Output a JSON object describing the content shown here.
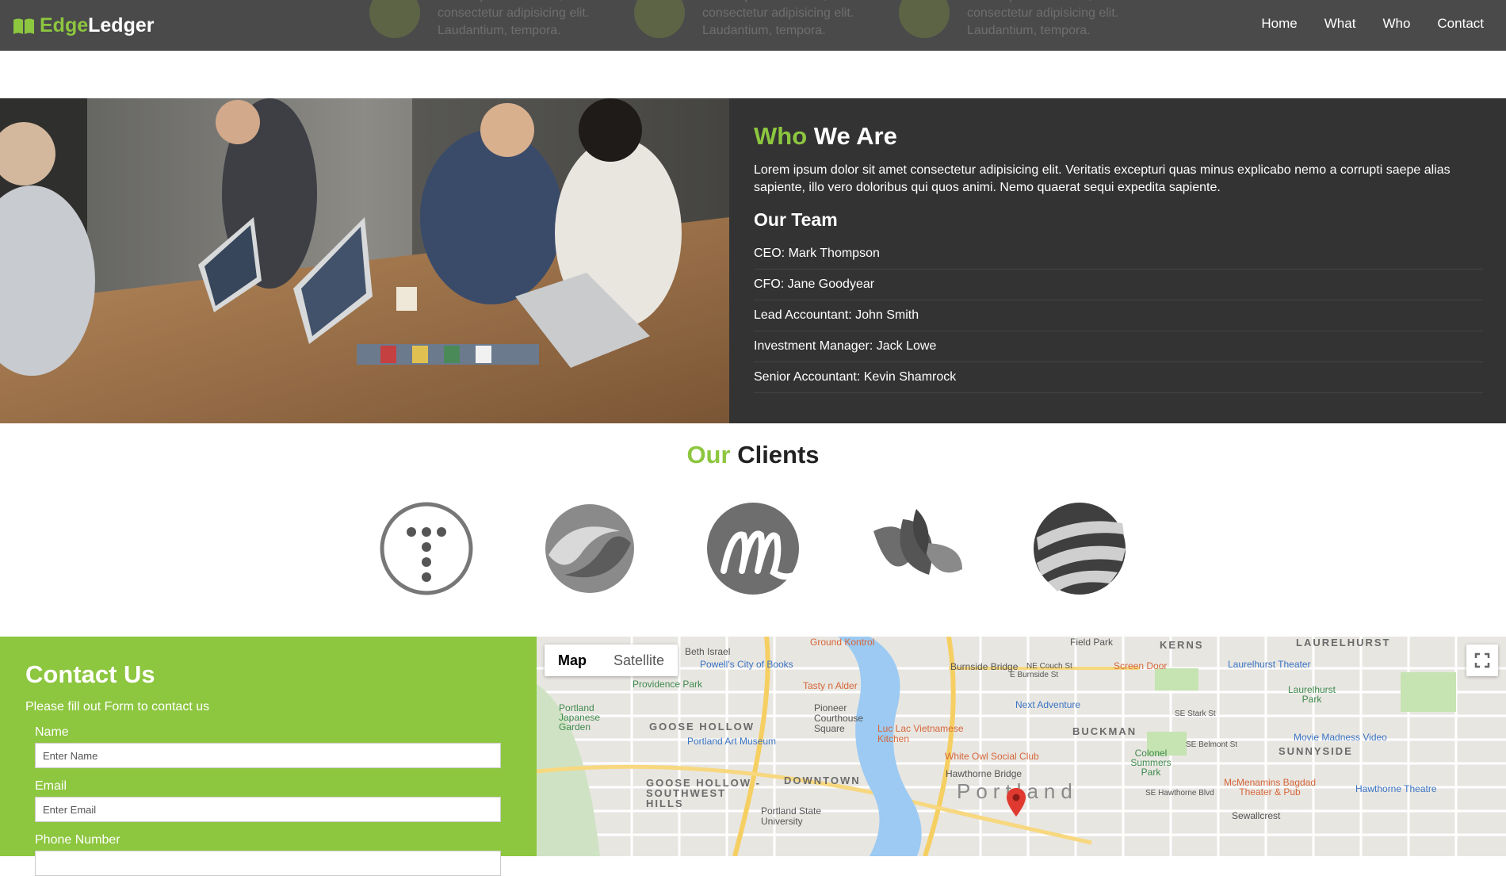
{
  "nav": {
    "brand_part1": "Edge",
    "brand_part2": "Ledger",
    "links": [
      "Home",
      "What",
      "Who",
      "Contact"
    ],
    "ghost_text": "Lorem ipsum dolor sit, amet consectetur adipisicing elit. Laudantium, tempora."
  },
  "who": {
    "title_accent": "Who",
    "title_rest": "We Are",
    "description": "Lorem ipsum dolor sit amet consectetur adipisicing elit. Veritatis excepturi quas minus explicabo nemo a corrupti saepe alias sapiente, illo vero doloribus qui quos animi. Nemo quaerat sequi expedita sapiente.",
    "team_title": "Our Team",
    "team": [
      "CEO: Mark Thompson",
      "CFO: Jane Goodyear",
      "Lead Accountant: John Smith",
      "Investment Manager: Jack Lowe",
      "Senior Accountant: Kevin Shamrock"
    ]
  },
  "clients": {
    "title_accent": "Our",
    "title_rest": "Clients",
    "logos": [
      "t-dots-logo",
      "swirl-sphere-logo",
      "m-circle-logo",
      "leaves-logo",
      "striped-globe-logo"
    ]
  },
  "contact": {
    "title": "Contact Us",
    "subtitle": "Please fill out Form to contact us",
    "fields": [
      {
        "label": "Name",
        "placeholder": "Enter Name"
      },
      {
        "label": "Email",
        "placeholder": "Enter Email"
      },
      {
        "label": "Phone Number",
        "placeholder": ""
      }
    ]
  },
  "map": {
    "toggle": [
      "Map",
      "Satellite"
    ],
    "active": "Map",
    "city": "Portland",
    "labels": {
      "beth_israel": "Beth Israel",
      "ground_kontrol": "Ground Kontrol",
      "powells": "Powell's City of Books",
      "providence_park": "Providence Park",
      "tasty": "Tasty n Alder",
      "pioneer": "Pioneer Courthouse Square",
      "japanese_garden": "Portland Japanese Garden",
      "goose_hollow": "GOOSE HOLLOW",
      "art_museum": "Portland Art Museum",
      "luc_lac": "Luc Lac Vietnamese Kitchen",
      "goose_hollow_sw": "GOOSE HOLLOW - SOUTHWEST HILLS",
      "downtown": "DOWNTOWN",
      "psu": "Portland State University",
      "burnside_bridge": "Burnside Bridge",
      "hawthorne_bridge": "Hawthorne Bridge",
      "next_adventure": "Next Adventure",
      "white_owl": "White Owl Social Club",
      "buckman": "BUCKMAN",
      "colonel": "Colonel Summers Park",
      "field_park": "Field Park",
      "kerns": "KERNS",
      "screen_door": "Screen Door",
      "laurelhurst": "LAURELHURST",
      "laurelhurst_theater": "Laurelhurst Theater",
      "laurelhurst_park": "Laurelhurst Park",
      "sunnyside": "SUNNYSIDE",
      "movie_madness": "Movie Madness Video",
      "mcmenamins": "McMenamins Bagdad Theater & Pub",
      "hawthorne_theatre": "Hawthorne Theatre",
      "sewallcrest": "Sewallcrest",
      "se_stark": "SE Stark St",
      "se_belmont": "SE Belmont St",
      "se_hawthorne": "SE Hawthorne Blvd",
      "e_burnside": "E Burnside St",
      "ne_couch": "NE Couch St"
    }
  },
  "colors": {
    "accent": "#8dc63f",
    "nav_bg": "#4a4a4a",
    "who_bg": "#333333"
  }
}
